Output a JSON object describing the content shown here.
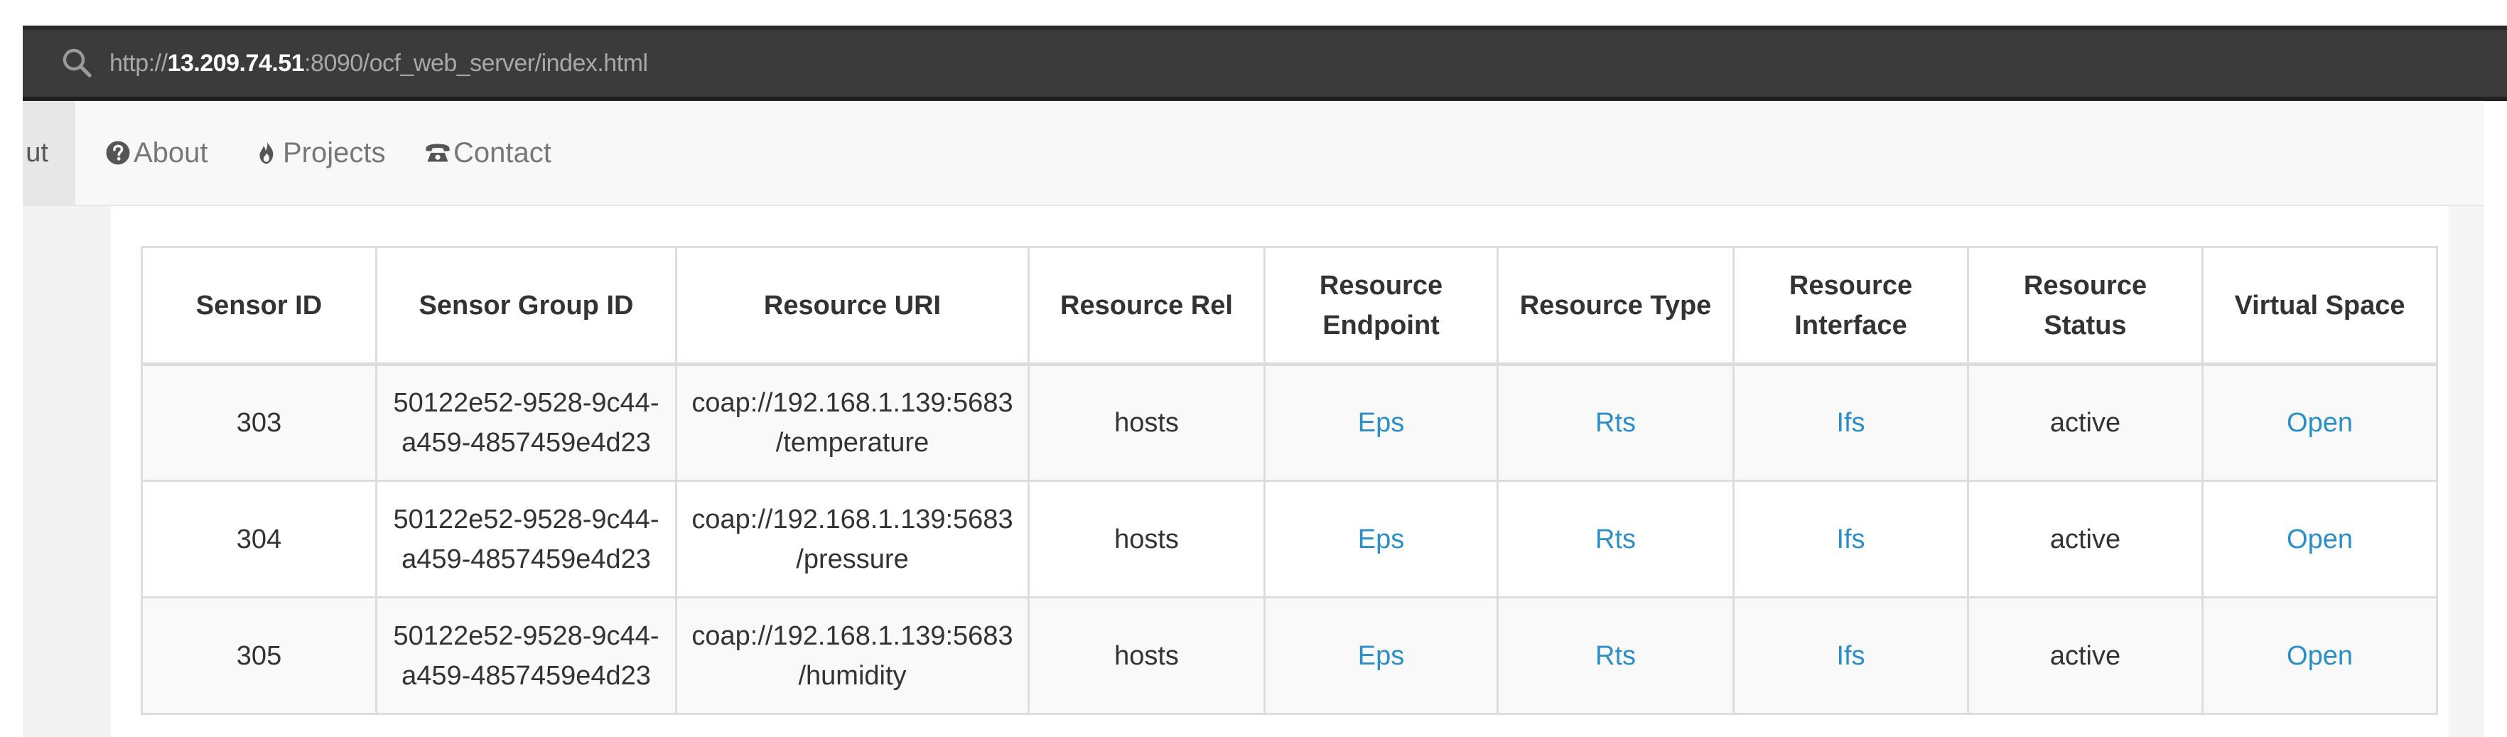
{
  "browser": {
    "url_prefix": "http://",
    "url_host": "13.209.74.51",
    "url_rest": ":8090/ocf_web_server/index.html"
  },
  "navbar": {
    "cut_item": "ut",
    "items": [
      {
        "label": "About",
        "icon": "question-circle-icon"
      },
      {
        "label": "Projects",
        "icon": "fire-icon"
      },
      {
        "label": "Contact",
        "icon": "phone-icon"
      }
    ]
  },
  "table": {
    "headers": {
      "sensor_id": "Sensor ID",
      "sensor_group_id": "Sensor Group ID",
      "resource_uri": "Resource URI",
      "resource_rel": "Resource Rel",
      "resource_endpoint_1": "Resource",
      "resource_endpoint_2": "Endpoint",
      "resource_type": "Resource Type",
      "resource_interface_1": "Resource",
      "resource_interface_2": "Interface",
      "resource_status_1": "Resource",
      "resource_status_2": "Status",
      "virtual_space": "Virtual Space"
    },
    "rows": [
      {
        "sensor_id": "303",
        "group_id_1": "50122e52-9528-9c44-",
        "group_id_2": "a459-4857459e4d23",
        "uri_1": "coap://192.168.1.139:5683",
        "uri_2": "/temperature",
        "rel": "hosts",
        "endpoint": "Eps",
        "type": "Rts",
        "interface": "Ifs",
        "status": "active",
        "virtual_space": "Open"
      },
      {
        "sensor_id": "304",
        "group_id_1": "50122e52-9528-9c44-",
        "group_id_2": "a459-4857459e4d23",
        "uri_1": "coap://192.168.1.139:5683",
        "uri_2": "/pressure",
        "rel": "hosts",
        "endpoint": "Eps",
        "type": "Rts",
        "interface": "Ifs",
        "status": "active",
        "virtual_space": "Open"
      },
      {
        "sensor_id": "305",
        "group_id_1": "50122e52-9528-9c44-",
        "group_id_2": "a459-4857459e4d23",
        "uri_1": "coap://192.168.1.139:5683",
        "uri_2": "/humidity",
        "rel": "hosts",
        "endpoint": "Eps",
        "type": "Rts",
        "interface": "Ifs",
        "status": "active",
        "virtual_space": "Open"
      }
    ]
  },
  "colors": {
    "address_bar": "#3b3b3b",
    "navbar": "#f8f8f8",
    "link": "#2a8fc9",
    "stripe": "#f9f9f9"
  }
}
